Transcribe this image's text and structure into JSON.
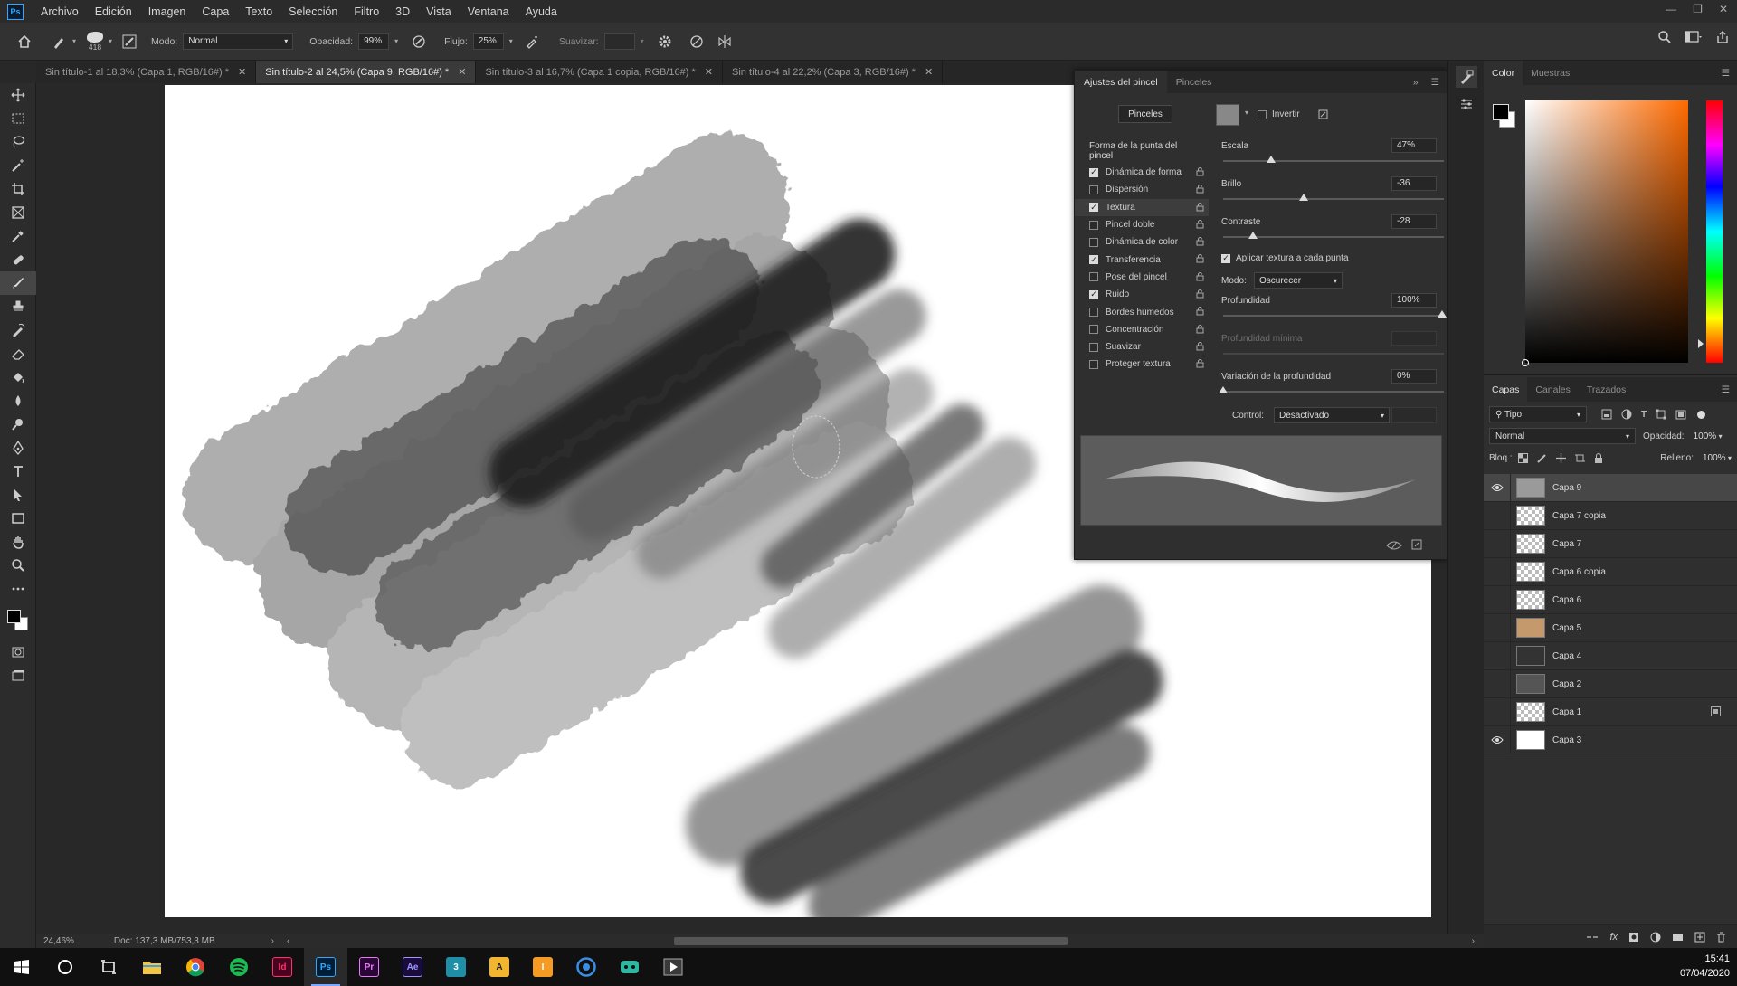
{
  "app": {
    "logo": "Ps"
  },
  "menu": [
    "Archivo",
    "Edición",
    "Imagen",
    "Capa",
    "Texto",
    "Selección",
    "Filtro",
    "3D",
    "Vista",
    "Ventana",
    "Ayuda"
  ],
  "options_bar": {
    "brush_size": "418",
    "mode_label": "Modo:",
    "mode_value": "Normal",
    "opacity_label": "Opacidad:",
    "opacity_value": "99%",
    "flow_label": "Flujo:",
    "flow_value": "25%",
    "smoothing_label": "Suavizar:",
    "smoothing_value": ""
  },
  "doc_tabs": [
    {
      "title": "Sin título-1 al 18,3% (Capa 1, RGB/16#) *",
      "active": false
    },
    {
      "title": "Sin título-2 al 24,5% (Capa 9, RGB/16#) *",
      "active": true
    },
    {
      "title": "Sin título-3 al 16,7% (Capa 1 copia, RGB/16#) *",
      "active": false
    },
    {
      "title": "Sin título-4 al 22,2% (Capa 3, RGB/16#) *",
      "active": false
    }
  ],
  "status": {
    "zoom": "24,46%",
    "doc": "Doc: 137,3 MB/753,3 MB"
  },
  "brush_settings": {
    "tabs": [
      "Ajustes del pincel",
      "Pinceles"
    ],
    "brushes_button": "Pinceles",
    "invert_label": "Invertir",
    "section_title": "Forma de la punta del pincel",
    "options": [
      {
        "label": "Dinámica de forma",
        "checked": true
      },
      {
        "label": "Dispersión",
        "checked": false
      },
      {
        "label": "Textura",
        "checked": true
      },
      {
        "label": "Pincel doble",
        "checked": false
      },
      {
        "label": "Dinámica de color",
        "checked": false
      },
      {
        "label": "Transferencia",
        "checked": true
      },
      {
        "label": "Pose del pincel",
        "checked": false
      },
      {
        "label": "Ruido",
        "checked": true
      },
      {
        "label": "Bordes húmedos",
        "checked": false
      },
      {
        "label": "Concentración",
        "checked": false
      },
      {
        "label": "Suavizar",
        "checked": false
      },
      {
        "label": "Proteger textura",
        "checked": false
      }
    ],
    "scale_label": "Escala",
    "scale_value": "47%",
    "scale_level": 0.47,
    "brightness_label": "Brillo",
    "brightness_value": "-36",
    "contrast_label": "Contraste",
    "contrast_value": "-28",
    "apply_each_tip": "Aplicar textura a cada punta",
    "mode_label": "Modo:",
    "mode_value": "Oscurecer",
    "depth_label": "Profundidad",
    "depth_value": "100%",
    "min_depth_label": "Profundidad mínima",
    "depth_jitter_label": "Variación de la profundidad",
    "depth_jitter_value": "0%",
    "control_label": "Control:",
    "control_value": "Desactivado"
  },
  "color_panel": {
    "tabs": [
      "Color",
      "Muestras"
    ],
    "hue_color": "#ff6a00"
  },
  "layers_panel": {
    "tabs": [
      "Capas",
      "Canales",
      "Trazados"
    ],
    "filter_value": "Tipo",
    "blend_mode": "Normal",
    "opacity_label": "Opacidad:",
    "opacity_value": "100%",
    "lock_label": "Bloq.:",
    "fill_label": "Relleno:",
    "fill_value": "100%",
    "layers": [
      {
        "name": "Capa 9",
        "visible": true,
        "selected": true
      },
      {
        "name": "Capa 7 copia",
        "visible": false,
        "selected": false
      },
      {
        "name": "Capa 7",
        "visible": false,
        "selected": false
      },
      {
        "name": "Capa 6 copia",
        "visible": false,
        "selected": false
      },
      {
        "name": "Capa 6",
        "visible": false,
        "selected": false
      },
      {
        "name": "Capa 5",
        "visible": false,
        "selected": false
      },
      {
        "name": "Capa 4",
        "visible": false,
        "selected": false
      },
      {
        "name": "Capa 2",
        "visible": false,
        "selected": false
      },
      {
        "name": "Capa 1",
        "visible": false,
        "selected": false
      },
      {
        "name": "Capa 3",
        "visible": true,
        "selected": false
      }
    ]
  },
  "taskbar": {
    "apps": [
      "Id",
      "Ps",
      "Pr",
      "Ae",
      "3",
      "A",
      "I"
    ],
    "time": "15:41",
    "date": "07/04/2020"
  }
}
